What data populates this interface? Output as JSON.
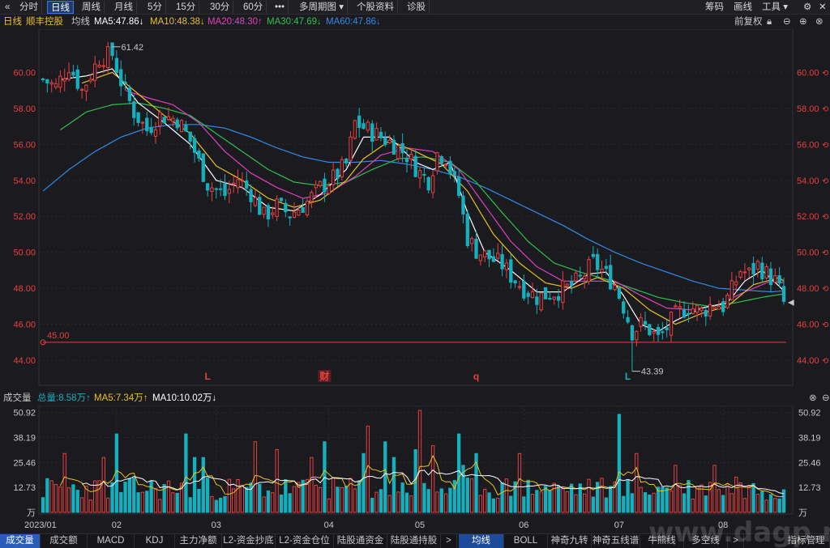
{
  "toolbar": {
    "back_icon": "«",
    "tabs": [
      {
        "label": "分时",
        "active": false
      },
      {
        "label": "日线",
        "active": true
      },
      {
        "label": "周线",
        "active": false
      },
      {
        "label": "月线",
        "active": false
      },
      {
        "label": "5分",
        "active": false
      },
      {
        "label": "15分",
        "active": false
      },
      {
        "label": "30分",
        "active": false
      },
      {
        "label": "60分",
        "active": false
      },
      {
        "label": "•••",
        "active": false
      },
      {
        "label": "多周期图 ▾",
        "active": false
      },
      {
        "label": "个股资料",
        "active": false
      },
      {
        "label": "诊股",
        "active": false
      }
    ],
    "right": {
      "code": "筹码",
      "draw": "画线",
      "tools": "工具 ▾"
    }
  },
  "ma_header": {
    "period": "日线",
    "stock": "顺丰控股",
    "mode": "均线",
    "ma5": "MA5:47.86↓",
    "ma10": "MA10:48.38↓",
    "ma20": "MA20:48.30↑",
    "ma30": "MA30:47.69↓",
    "ma60": "MA60:47.86↓",
    "adjust": "前复权"
  },
  "vol_header": {
    "title": "成交量",
    "total": "总量:8.58万↑",
    "ma5": "MA5:7.34万↑",
    "ma10": "MA10:10.02万↓"
  },
  "colors": {
    "up": "#e84040",
    "down": "#14b0be",
    "ma5": "#ffffff",
    "ma10": "#e8c21c",
    "ma20": "#e040c0",
    "ma30": "#2ec050",
    "ma60": "#2e8ce8"
  },
  "chart_data": {
    "type": "candlestick",
    "price_ticks": [
      "60.00",
      "58.00",
      "56.00",
      "54.00",
      "52.00",
      "50.00",
      "48.00",
      "46.00",
      "44.00"
    ],
    "price_tick_values": [
      60,
      58,
      56,
      54,
      52,
      50,
      48,
      46,
      44
    ],
    "ylim": [
      42.7,
      62.4
    ],
    "annotations": {
      "high": "61.42",
      "low": "43.39",
      "hline": "45.00"
    },
    "hline_value": 45.0,
    "event_markers": [
      {
        "text": "L",
        "index": 38,
        "color": "#e84040"
      },
      {
        "text": "财",
        "index": 65,
        "color": "#e84040",
        "boxed": true
      },
      {
        "text": "q",
        "index": 100,
        "color": "#e84040"
      },
      {
        "text": "L",
        "index": 135,
        "color": "#14b0be"
      }
    ],
    "month_labels": [
      "2023/01",
      "02",
      "03",
      "04",
      "05",
      "06",
      "07",
      "08"
    ],
    "month_index": [
      0,
      17,
      40,
      66,
      87,
      111,
      133,
      157
    ],
    "vol_ticks": [
      "50.92",
      "38.19",
      "25.46",
      "12.73",
      "万"
    ],
    "vol_tick_values": [
      50.92,
      38.19,
      25.46,
      12.73,
      0
    ],
    "vol_ylim": [
      0,
      52
    ],
    "anchors": [
      [
        0,
        59.6
      ],
      [
        3,
        59.2
      ],
      [
        6,
        60.4
      ],
      [
        9,
        59.0
      ],
      [
        13,
        60.8
      ],
      [
        16,
        61.0
      ],
      [
        18,
        59.5
      ],
      [
        21,
        57.8
      ],
      [
        24,
        56.8
      ],
      [
        27,
        57.6
      ],
      [
        31,
        57.4
      ],
      [
        34,
        56.2
      ],
      [
        36,
        55.0
      ],
      [
        38,
        53.8
      ],
      [
        42,
        53.2
      ],
      [
        45,
        54.1
      ],
      [
        48,
        53.3
      ],
      [
        51,
        52.0
      ],
      [
        54,
        52.6
      ],
      [
        57,
        52.1
      ],
      [
        61,
        52.8
      ],
      [
        64,
        53.6
      ],
      [
        67,
        54.1
      ],
      [
        70,
        54.9
      ],
      [
        72,
        57.2
      ],
      [
        75,
        56.8
      ],
      [
        78,
        56.4
      ],
      [
        81,
        56.0
      ],
      [
        84,
        55.4
      ],
      [
        87,
        54.4
      ],
      [
        89,
        54.0
      ],
      [
        91,
        55.5
      ],
      [
        93,
        55.3
      ],
      [
        96,
        53.2
      ],
      [
        98,
        50.8
      ],
      [
        100,
        50.1
      ],
      [
        103,
        49.7
      ],
      [
        106,
        49.3
      ],
      [
        108,
        48.7
      ],
      [
        111,
        48.0
      ],
      [
        114,
        47.5
      ],
      [
        117,
        47.7
      ],
      [
        121,
        48.0
      ],
      [
        124,
        48.5
      ],
      [
        127,
        49.4
      ],
      [
        129,
        49.0
      ],
      [
        132,
        48.2
      ],
      [
        134,
        47.0
      ],
      [
        136,
        45.6
      ],
      [
        138,
        46.0
      ],
      [
        140,
        45.7
      ],
      [
        142,
        45.2
      ],
      [
        144,
        45.8
      ],
      [
        146,
        46.5
      ],
      [
        149,
        47.0
      ],
      [
        152,
        46.7
      ],
      [
        155,
        47.2
      ],
      [
        157,
        47.0
      ],
      [
        159,
        47.9
      ],
      [
        161,
        49.0
      ],
      [
        163,
        48.8
      ],
      [
        165,
        49.3
      ],
      [
        167,
        48.8
      ],
      [
        169,
        48.4
      ],
      [
        170,
        47.9
      ],
      [
        171,
        47.2
      ]
    ],
    "ma_anchors": {
      "ma5": [
        [
          4,
          59.6
        ],
        [
          10,
          59.8
        ],
        [
          16,
          60.2
        ],
        [
          22,
          58.3
        ],
        [
          28,
          57.2
        ],
        [
          34,
          56.0
        ],
        [
          40,
          54.0
        ],
        [
          46,
          53.6
        ],
        [
          52,
          52.5
        ],
        [
          58,
          52.3
        ],
        [
          64,
          53.2
        ],
        [
          70,
          54.6
        ],
        [
          74,
          56.4
        ],
        [
          80,
          56.4
        ],
        [
          86,
          55.0
        ],
        [
          90,
          54.6
        ],
        [
          94,
          55.0
        ],
        [
          98,
          52.2
        ],
        [
          102,
          50.0
        ],
        [
          108,
          49.0
        ],
        [
          114,
          47.8
        ],
        [
          120,
          47.8
        ],
        [
          126,
          48.8
        ],
        [
          130,
          48.9
        ],
        [
          134,
          47.6
        ],
        [
          138,
          46.0
        ],
        [
          142,
          45.6
        ],
        [
          146,
          46.2
        ],
        [
          152,
          46.9
        ],
        [
          158,
          47.2
        ],
        [
          162,
          48.4
        ],
        [
          166,
          49.0
        ],
        [
          170,
          48.1
        ],
        [
          171,
          47.86
        ]
      ],
      "ma10": [
        [
          9,
          59.4
        ],
        [
          16,
          60.0
        ],
        [
          22,
          58.8
        ],
        [
          28,
          57.6
        ],
        [
          34,
          56.6
        ],
        [
          40,
          54.8
        ],
        [
          46,
          54.0
        ],
        [
          52,
          53.0
        ],
        [
          58,
          52.5
        ],
        [
          64,
          52.9
        ],
        [
          70,
          54.0
        ],
        [
          74,
          55.2
        ],
        [
          80,
          56.2
        ],
        [
          86,
          55.6
        ],
        [
          92,
          54.9
        ],
        [
          98,
          53.4
        ],
        [
          104,
          51.0
        ],
        [
          110,
          49.4
        ],
        [
          116,
          48.3
        ],
        [
          122,
          48.0
        ],
        [
          128,
          48.6
        ],
        [
          134,
          48.0
        ],
        [
          140,
          46.8
        ],
        [
          146,
          46.0
        ],
        [
          152,
          46.6
        ],
        [
          158,
          47.0
        ],
        [
          164,
          48.2
        ],
        [
          170,
          48.6
        ],
        [
          171,
          48.38
        ]
      ],
      "ma20": [
        [
          19,
          59.0
        ],
        [
          24,
          58.6
        ],
        [
          30,
          58.2
        ],
        [
          36,
          57.2
        ],
        [
          42,
          55.6
        ],
        [
          48,
          54.4
        ],
        [
          54,
          53.6
        ],
        [
          60,
          53.0
        ],
        [
          66,
          53.3
        ],
        [
          72,
          54.2
        ],
        [
          78,
          55.4
        ],
        [
          84,
          55.8
        ],
        [
          90,
          55.6
        ],
        [
          96,
          54.6
        ],
        [
          102,
          52.6
        ],
        [
          108,
          50.6
        ],
        [
          114,
          49.2
        ],
        [
          120,
          48.4
        ],
        [
          126,
          48.4
        ],
        [
          132,
          48.4
        ],
        [
          138,
          47.6
        ],
        [
          144,
          46.9
        ],
        [
          150,
          46.8
        ],
        [
          156,
          47.1
        ],
        [
          162,
          47.8
        ],
        [
          168,
          48.4
        ],
        [
          171,
          48.3
        ]
      ],
      "ma30": [
        [
          4,
          56.8
        ],
        [
          10,
          57.8
        ],
        [
          16,
          58.2
        ],
        [
          22,
          58.3
        ],
        [
          28,
          58.0
        ],
        [
          34,
          57.6
        ],
        [
          40,
          56.6
        ],
        [
          46,
          55.6
        ],
        [
          52,
          54.6
        ],
        [
          58,
          53.9
        ],
        [
          64,
          53.7
        ],
        [
          70,
          53.9
        ],
        [
          76,
          54.6
        ],
        [
          82,
          55.2
        ],
        [
          88,
          55.3
        ],
        [
          94,
          55.0
        ],
        [
          100,
          53.9
        ],
        [
          106,
          52.2
        ],
        [
          112,
          50.6
        ],
        [
          118,
          49.4
        ],
        [
          124,
          48.9
        ],
        [
          130,
          48.5
        ],
        [
          136,
          48.0
        ],
        [
          142,
          47.5
        ],
        [
          148,
          47.2
        ],
        [
          154,
          47.0
        ],
        [
          160,
          47.2
        ],
        [
          166,
          47.5
        ],
        [
          171,
          47.69
        ]
      ],
      "ma60": [
        [
          0,
          53.4
        ],
        [
          6,
          54.6
        ],
        [
          12,
          55.6
        ],
        [
          18,
          56.4
        ],
        [
          24,
          56.9
        ],
        [
          30,
          57.1
        ],
        [
          36,
          57.1
        ],
        [
          42,
          56.9
        ],
        [
          48,
          56.4
        ],
        [
          54,
          55.8
        ],
        [
          60,
          55.3
        ],
        [
          66,
          55.0
        ],
        [
          72,
          55.0
        ],
        [
          78,
          55.1
        ],
        [
          84,
          54.9
        ],
        [
          90,
          54.6
        ],
        [
          96,
          54.2
        ],
        [
          102,
          53.6
        ],
        [
          108,
          52.9
        ],
        [
          114,
          52.2
        ],
        [
          120,
          51.5
        ],
        [
          126,
          50.7
        ],
        [
          132,
          50.0
        ],
        [
          138,
          49.4
        ],
        [
          144,
          48.9
        ],
        [
          150,
          48.4
        ],
        [
          156,
          48.0
        ],
        [
          162,
          47.9
        ],
        [
          168,
          47.8
        ],
        [
          171,
          47.86
        ]
      ]
    },
    "vol_spikes": [
      [
        5,
        30
      ],
      [
        14,
        28
      ],
      [
        17,
        40
      ],
      [
        33,
        40
      ],
      [
        35,
        28
      ],
      [
        37,
        28
      ],
      [
        49,
        36
      ],
      [
        54,
        32
      ],
      [
        62,
        28
      ],
      [
        65,
        36
      ],
      [
        74,
        30
      ],
      [
        75,
        44
      ],
      [
        79,
        36
      ],
      [
        81,
        28
      ],
      [
        86,
        32
      ],
      [
        87,
        52
      ],
      [
        90,
        34
      ],
      [
        96,
        40
      ],
      [
        97,
        24
      ],
      [
        100,
        30
      ],
      [
        110,
        30
      ],
      [
        133,
        50
      ],
      [
        137,
        30
      ],
      [
        146,
        24
      ],
      [
        155,
        24
      ],
      [
        160,
        18
      ]
    ]
  },
  "bottom_tabs": [
    {
      "label": "成交量",
      "active": true
    },
    {
      "label": "成交额",
      "active": false
    },
    {
      "label": "MACD",
      "active": false
    },
    {
      "label": "KDJ",
      "active": false
    },
    {
      "label": "主力净额",
      "active": false
    },
    {
      "label": "L2-资金抄底",
      "active": false
    },
    {
      "label": "L2-资金仓位",
      "active": false
    },
    {
      "label": "陆股通资金",
      "active": false
    },
    {
      "label": "陆股通持股",
      "active": false
    },
    {
      "label": ">",
      "active": false
    },
    {
      "label": "均线",
      "active": true
    },
    {
      "label": "BOLL",
      "active": false
    },
    {
      "label": "神奇九转",
      "active": false
    },
    {
      "label": "神奇五线谱",
      "active": false
    },
    {
      "label": "牛熊线",
      "active": false
    },
    {
      "label": "多空线",
      "active": false
    },
    {
      "label": ">",
      "active": false
    },
    {
      "label": "指标管理",
      "active": false
    }
  ],
  "watermark": "www.dagp.net"
}
